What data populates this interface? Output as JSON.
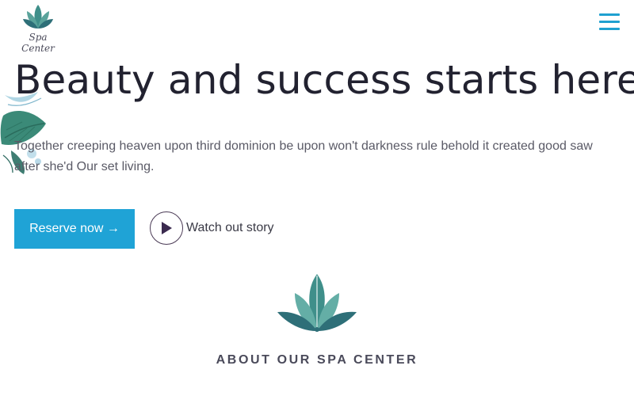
{
  "brand": {
    "name": "Spa Center",
    "logo_icon": "lotus-icon",
    "accent": "#1fa3d6"
  },
  "nav": {
    "menu_icon": "hamburger-menu-icon"
  },
  "hero": {
    "title": "Beauty and success starts here",
    "text": "Together creeping heaven upon third dominion be upon won't darkness rule behold it created good saw after she'd Our set living.",
    "reserve_label": "Reserve now →",
    "watch_label": "Watch out story",
    "play_icon": "play-icon"
  },
  "about": {
    "heading": "ABOUT OUR SPA CENTER",
    "icon": "lotus-icon"
  }
}
